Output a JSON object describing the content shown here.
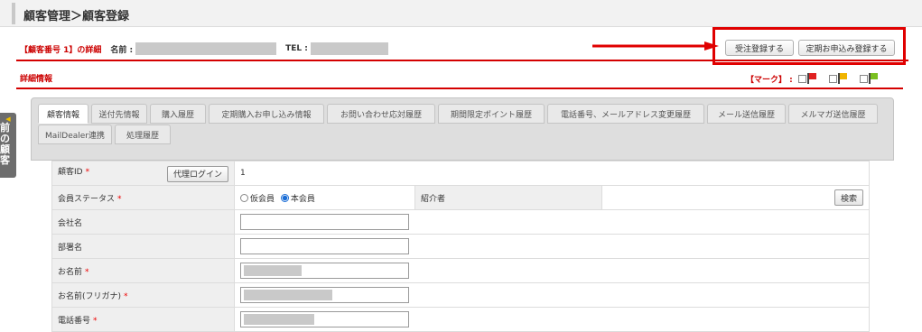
{
  "header": {
    "title": "顧客管理＞顧客登録"
  },
  "customer": {
    "detail_label": "【顧客番号 1】の詳細",
    "name_label": "名前 :",
    "tel_label": "TEL :"
  },
  "actions": {
    "order_register": "受注登録する",
    "subscription_register": "定期お申込み登録する"
  },
  "section": {
    "title": "詳細情報",
    "mark_label": "【マーク】 :"
  },
  "marks": [
    {
      "name": "red-flag",
      "color": "#e02020"
    },
    {
      "name": "yellow-flag",
      "color": "#f0b400"
    },
    {
      "name": "green-flag",
      "color": "#7ac020"
    }
  ],
  "sidebar": {
    "prev_customer": "前の顧客"
  },
  "tabs": [
    "顧客情報",
    "送付先情報",
    "購入履歴",
    "定期購入お申し込み情報",
    "お問い合わせ応対履歴",
    "期間限定ポイント履歴",
    "電話番号、メールアドレス変更履歴",
    "メール送信履歴",
    "メルマガ送信履歴",
    "MailDealer連携",
    "処理履歴"
  ],
  "form": {
    "customer_id": {
      "label": "顧客ID",
      "required": "*",
      "proxy_login": "代理ログイン",
      "value": "1"
    },
    "member_status": {
      "label": "会員ステータス",
      "required": "*",
      "opt_temp": "仮会員",
      "opt_full": "本会員",
      "selected": "本会員"
    },
    "referrer": {
      "label": "紹介者",
      "search": "検索"
    },
    "company": {
      "label": "会社名"
    },
    "department": {
      "label": "部署名"
    },
    "name": {
      "label": "お名前",
      "required": "*"
    },
    "name_kana": {
      "label": "お名前(フリガナ)",
      "required": "*"
    },
    "phone": {
      "label": "電話番号",
      "required": "*"
    }
  },
  "colors": {
    "accent_red": "#d40000",
    "highlight_box": "#e00000",
    "radio_blue": "#1a6dd6"
  }
}
